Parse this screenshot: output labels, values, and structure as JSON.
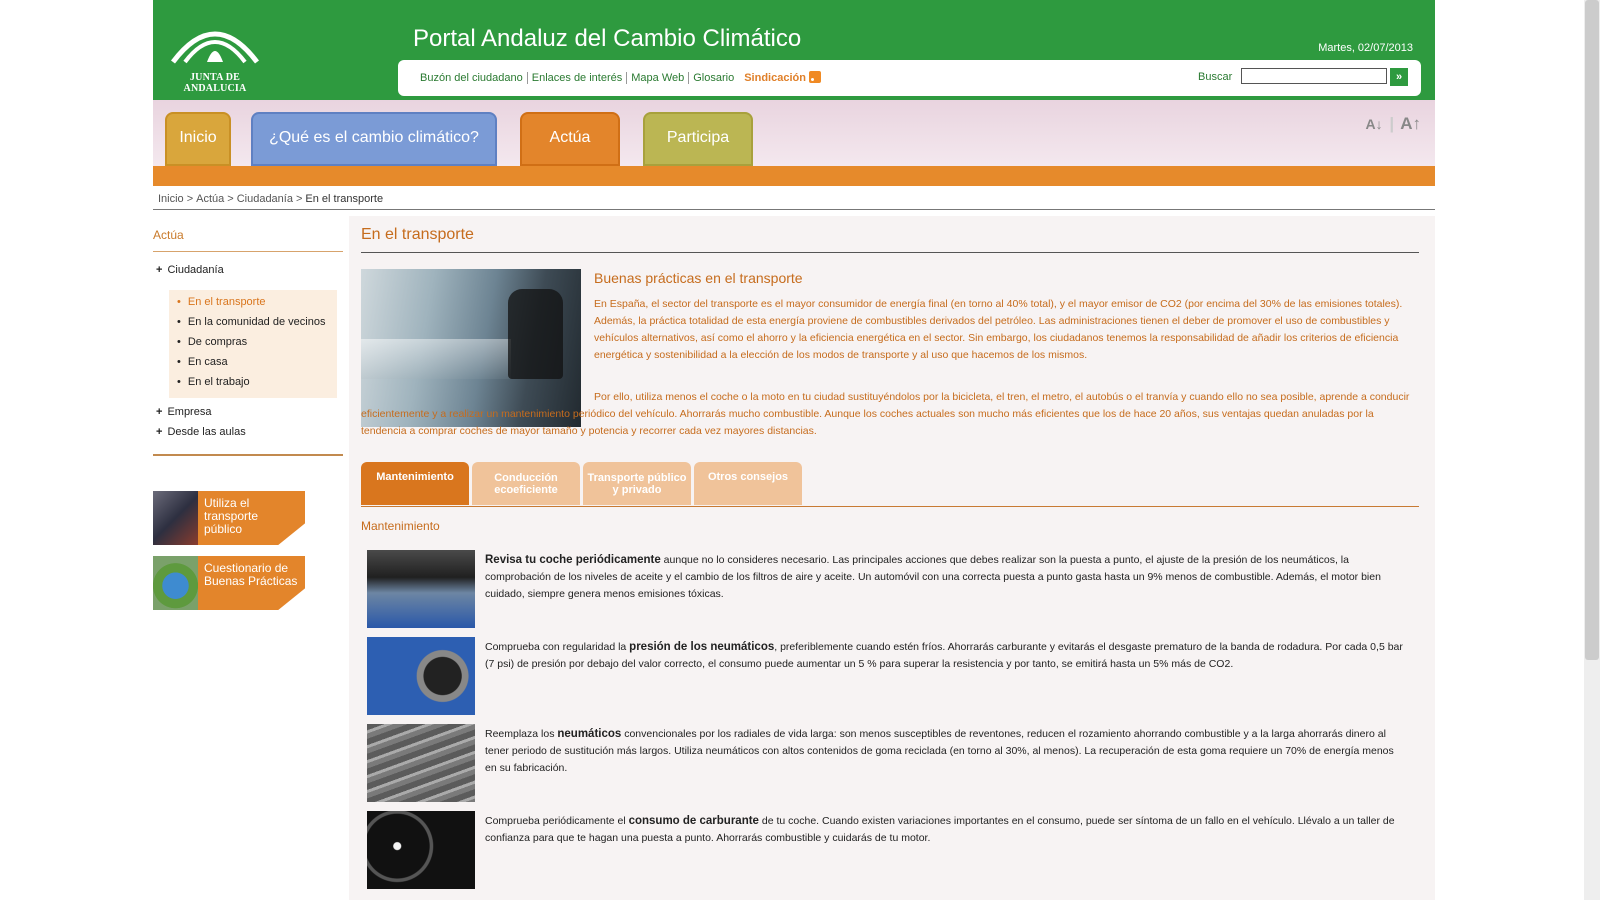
{
  "header": {
    "logo_text": "JUNTA DE ANDALUCIA",
    "site_title": "Portal Andaluz del Cambio Climático",
    "date": "Martes, 02/07/2013",
    "util_links": [
      "Buzón del ciudadano",
      "Enlaces de interés",
      "Mapa Web",
      "Glosario"
    ],
    "syndication_label": "Sindicación",
    "search_label": "Buscar",
    "search_value": "",
    "search_button": "»"
  },
  "nav": {
    "tabs": [
      "Inicio",
      "¿Qué es el cambio climático?",
      "Actúa",
      "Participa"
    ],
    "font_decrease": "A",
    "font_increase": "A"
  },
  "breadcrumb": {
    "items": [
      "Inicio",
      "Actúa",
      "Ciudadanía"
    ],
    "current": "En el transporte",
    "separator": ">"
  },
  "sidebar": {
    "heading": "Actúa",
    "sections": [
      {
        "toggle": "+",
        "label": "Ciudadanía"
      },
      {
        "toggle": "+",
        "label": "Empresa"
      },
      {
        "toggle": "+",
        "label": "Desde las aulas"
      }
    ],
    "subitems": [
      "En el transporte",
      "En la comunidad de vecinos",
      "De compras",
      "En casa",
      "En el trabajo"
    ],
    "promos": [
      "Utiliza el transporte público",
      "Cuestionario de Buenas Prácticas"
    ]
  },
  "main": {
    "title": "En el transporte",
    "intro_title": "Buenas prácticas en el transporte",
    "intro_p1": "En España, el sector del transporte es el mayor consumidor de energía final (en torno al 40% total), y el mayor emisor de CO2 (por encima del 30% de las emisiones totales). Además, la práctica totalidad de esta energía proviene de combustibles derivados del petróleo. Las administraciones tienen el deber de promover el uso de combustibles y vehículos alternativos, así como el ahorro y la eficiencia energética en el sector. Sin embargo, los ciudadanos tenemos la responsabilidad de añadir los criterios de eficiencia energética y sostenibilidad a la elección de los modos de transporte y al uso que hacemos de los mismos.",
    "intro_p2": "Por ello, utiliza menos el coche o la moto en tu ciudad sustituyéndolos por la bicicleta, el tren, el metro, el autobús o el tranvía y cuando ello no sea posible, aprende a conducir eficientemente y a realizar un mantenimiento periódico del vehículo. Ahorrarás mucho combustible. Aunque los coches actuales son mucho más eficientes que los de hace 20 años, sus ventajas quedan anuladas por la tendencia a comprar coches de mayor tamaño y potencia y recorrer cada vez mayores distancias.",
    "tabs": [
      "Mantenimiento",
      "Conducción ecoeficiente",
      "Transporte público y privado",
      "Otros consejos"
    ],
    "section_title": "Mantenimiento",
    "tips": [
      {
        "pre": "",
        "bold": "Revisa tu coche periódicamente",
        "post": " aunque no lo consideres necesario. Las principales acciones que debes realizar son la puesta a punto, el ajuste de la presión de los neumáticos, la comprobación de los niveles de aceite y el cambio de los filtros de aire y aceite. Un automóvil con una correcta puesta a punto gasta hasta un 9% menos de combustible. Además, el motor bien cuidado, siempre genera menos emisiones tóxicas."
      },
      {
        "pre": "Comprueba con regularidad la ",
        "bold": "presión de los neumáticos",
        "post": ", preferiblemente cuando estén fríos. Ahorrarás carburante y evitarás el desgaste prematuro de la banda de rodadura. Por cada 0,5 bar (7 psi) de presión por debajo del valor correcto, el consumo puede aumentar un 5 % para superar la resistencia y por tanto, se emitirá hasta un 5% más de CO2."
      },
      {
        "pre": "Reemplaza los ",
        "bold": "neumáticos",
        "post": " convencionales por los radiales de vida larga: son menos susceptibles de reventones, reducen el rozamiento ahorrando combustible y a la larga ahorrarás dinero al tener periodo de sustitución más largos. Utiliza neumáticos con altos contenidos de goma reciclada (en torno al 30%, al menos). La recuperación de esta goma requiere un 70% de energía menos en su fabricación."
      },
      {
        "pre": "Comprueba periódicamente el ",
        "bold": "consumo de carburante",
        "post": " de tu coche. Cuando existen variaciones importantes en el consumo, puede ser síntoma de un fallo en el vehículo. Llévalo a un taller de confianza para que te hagan una puesta a punto. Ahorrarás combustible y cuidarás de tu motor."
      }
    ]
  }
}
